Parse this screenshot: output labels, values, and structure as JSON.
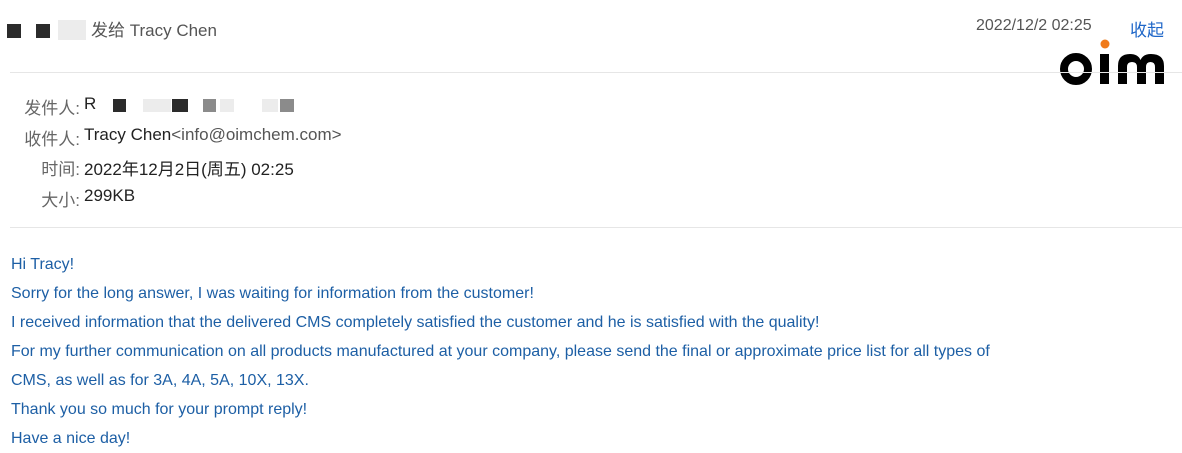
{
  "header": {
    "sent_to": "发给 Tracy Chen",
    "date": "2022/12/2  02:25",
    "collapse_label": "收起"
  },
  "logo": {
    "text": "oim",
    "dot_color": "#f07a1a"
  },
  "meta": {
    "from_label": "发件人:",
    "from_value": "R",
    "to_label": "收件人:",
    "to_name": "Tracy Chen",
    "to_email": "<info@oimchem.com>",
    "time_label": "时间:",
    "time_value": "2022年12月2日(周五) 02:25",
    "size_label": "大小:",
    "size_value": "299KB"
  },
  "body": {
    "lines": [
      "Hi Tracy!",
      "Sorry for the long answer, I was waiting for information from the customer!",
      "I received information that the delivered CMS completely satisfied the customer and he is satisfied with the quality!",
      "For my further communication on all products manufactured at your company, please send the final or approximate price list for all types of",
      "CMS, as well as for 3A, 4A, 5A, 10X, 13X.",
      "Thank you so much for your prompt reply!",
      "Have a nice day!"
    ]
  },
  "colors": {
    "body_text": "#1d5fa5",
    "link": "#1e66c8",
    "divider": "#e6e6e6"
  }
}
